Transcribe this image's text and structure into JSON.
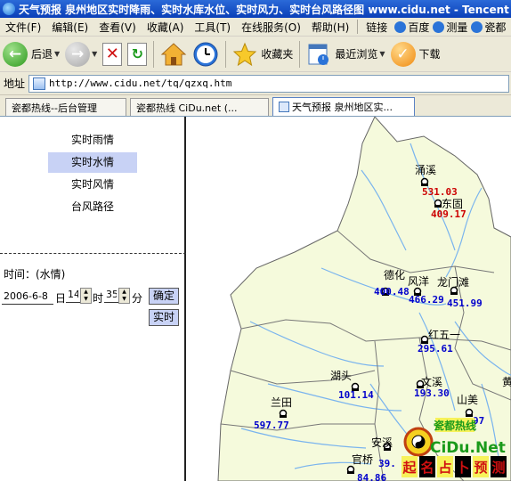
{
  "window": {
    "title": "天气预报 泉州地区实时降雨、实时水库水位、实时风力、实时台风路径图 www.cidu.net - Tencent"
  },
  "menu": [
    "文件(F)",
    "编辑(E)",
    "查看(V)",
    "收藏(A)",
    "工具(T)",
    "在线服务(O)",
    "帮助(H)"
  ],
  "links": {
    "label": "链接",
    "items": [
      "百度",
      "测量",
      "瓷都"
    ]
  },
  "toolbar": {
    "back": "后退",
    "favorites": "收藏夹",
    "recent": "最近浏览",
    "download": "下载"
  },
  "address": {
    "label": "地址",
    "url": "http://www.cidu.net/tq/qzxq.htm"
  },
  "tabs": [
    "瓷都热线--后台管理",
    "瓷都热线 CiDu.net (...",
    "天气预报 泉州地区实..."
  ],
  "sidebar": {
    "items": [
      "实时雨情",
      "实时水情",
      "实时风情",
      "台风路径"
    ],
    "selected": 1
  },
  "form": {
    "time_label": "时间：(水情)",
    "date": "2006-6-8",
    "day_unit": "日",
    "hour": "14",
    "hour_unit": "时",
    "minute": "35",
    "minute_unit": "分",
    "confirm": "确定",
    "realtime": "实时"
  },
  "map": {
    "stations": [
      {
        "name": "涌溪",
        "value": "531.03",
        "value_color": "#cc0000"
      },
      {
        "name": "东固",
        "value": "409.17",
        "value_color": "#cc0000"
      },
      {
        "name": "德化",
        "value": "400.48",
        "value_color": "#0000cc"
      },
      {
        "name": "风洋",
        "value": "466.29",
        "value_color": "#0000cc"
      },
      {
        "name": "龙门滩",
        "value": "451.99",
        "value_color": "#0000cc"
      },
      {
        "name": "红五一",
        "value": "295.61",
        "value_color": "#0000cc"
      },
      {
        "name": "湖头",
        "value": "101.14",
        "value_color": "#0000cc"
      },
      {
        "name": "文溪",
        "value": "193.30",
        "value_color": "#0000cc"
      },
      {
        "name": "兰田",
        "value": "597.77",
        "value_color": "#0000cc"
      },
      {
        "name": "山美",
        "value": "97",
        "value_color": "#0000cc"
      },
      {
        "name": "安溪",
        "value": "39.",
        "value_color": "#0000cc"
      },
      {
        "name": "官桥",
        "value": "84.86",
        "value_color": "#0000cc"
      }
    ],
    "partial_label": "黄",
    "logo": {
      "text": "CiDu.Net",
      "top": "瓷都热线",
      "bottom": [
        "起",
        "名",
        "占",
        "卜",
        "预",
        "测"
      ]
    }
  },
  "colors": {
    "land": "#f5fadc",
    "river": "#7ab4ee",
    "border": "#666666",
    "selected": "#c8d2f5"
  }
}
